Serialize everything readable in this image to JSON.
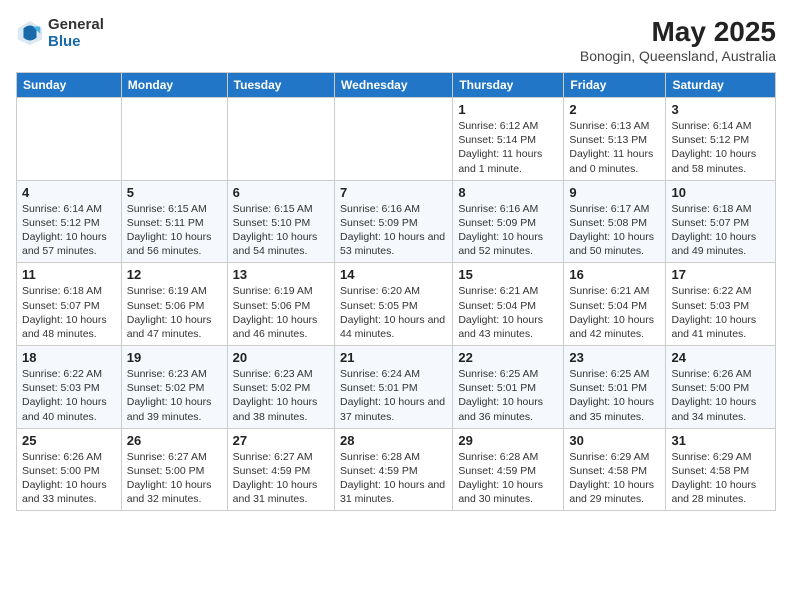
{
  "header": {
    "logo_general": "General",
    "logo_blue": "Blue",
    "month_year": "May 2025",
    "location": "Bonogin, Queensland, Australia"
  },
  "days_of_week": [
    "Sunday",
    "Monday",
    "Tuesday",
    "Wednesday",
    "Thursday",
    "Friday",
    "Saturday"
  ],
  "weeks": [
    [
      {
        "day": "",
        "content": ""
      },
      {
        "day": "",
        "content": ""
      },
      {
        "day": "",
        "content": ""
      },
      {
        "day": "",
        "content": ""
      },
      {
        "day": "1",
        "content": "Sunrise: 6:12 AM\nSunset: 5:14 PM\nDaylight: 11 hours and 1 minute."
      },
      {
        "day": "2",
        "content": "Sunrise: 6:13 AM\nSunset: 5:13 PM\nDaylight: 11 hours and 0 minutes."
      },
      {
        "day": "3",
        "content": "Sunrise: 6:14 AM\nSunset: 5:12 PM\nDaylight: 10 hours and 58 minutes."
      }
    ],
    [
      {
        "day": "4",
        "content": "Sunrise: 6:14 AM\nSunset: 5:12 PM\nDaylight: 10 hours and 57 minutes."
      },
      {
        "day": "5",
        "content": "Sunrise: 6:15 AM\nSunset: 5:11 PM\nDaylight: 10 hours and 56 minutes."
      },
      {
        "day": "6",
        "content": "Sunrise: 6:15 AM\nSunset: 5:10 PM\nDaylight: 10 hours and 54 minutes."
      },
      {
        "day": "7",
        "content": "Sunrise: 6:16 AM\nSunset: 5:09 PM\nDaylight: 10 hours and 53 minutes."
      },
      {
        "day": "8",
        "content": "Sunrise: 6:16 AM\nSunset: 5:09 PM\nDaylight: 10 hours and 52 minutes."
      },
      {
        "day": "9",
        "content": "Sunrise: 6:17 AM\nSunset: 5:08 PM\nDaylight: 10 hours and 50 minutes."
      },
      {
        "day": "10",
        "content": "Sunrise: 6:18 AM\nSunset: 5:07 PM\nDaylight: 10 hours and 49 minutes."
      }
    ],
    [
      {
        "day": "11",
        "content": "Sunrise: 6:18 AM\nSunset: 5:07 PM\nDaylight: 10 hours and 48 minutes."
      },
      {
        "day": "12",
        "content": "Sunrise: 6:19 AM\nSunset: 5:06 PM\nDaylight: 10 hours and 47 minutes."
      },
      {
        "day": "13",
        "content": "Sunrise: 6:19 AM\nSunset: 5:06 PM\nDaylight: 10 hours and 46 minutes."
      },
      {
        "day": "14",
        "content": "Sunrise: 6:20 AM\nSunset: 5:05 PM\nDaylight: 10 hours and 44 minutes."
      },
      {
        "day": "15",
        "content": "Sunrise: 6:21 AM\nSunset: 5:04 PM\nDaylight: 10 hours and 43 minutes."
      },
      {
        "day": "16",
        "content": "Sunrise: 6:21 AM\nSunset: 5:04 PM\nDaylight: 10 hours and 42 minutes."
      },
      {
        "day": "17",
        "content": "Sunrise: 6:22 AM\nSunset: 5:03 PM\nDaylight: 10 hours and 41 minutes."
      }
    ],
    [
      {
        "day": "18",
        "content": "Sunrise: 6:22 AM\nSunset: 5:03 PM\nDaylight: 10 hours and 40 minutes."
      },
      {
        "day": "19",
        "content": "Sunrise: 6:23 AM\nSunset: 5:02 PM\nDaylight: 10 hours and 39 minutes."
      },
      {
        "day": "20",
        "content": "Sunrise: 6:23 AM\nSunset: 5:02 PM\nDaylight: 10 hours and 38 minutes."
      },
      {
        "day": "21",
        "content": "Sunrise: 6:24 AM\nSunset: 5:01 PM\nDaylight: 10 hours and 37 minutes."
      },
      {
        "day": "22",
        "content": "Sunrise: 6:25 AM\nSunset: 5:01 PM\nDaylight: 10 hours and 36 minutes."
      },
      {
        "day": "23",
        "content": "Sunrise: 6:25 AM\nSunset: 5:01 PM\nDaylight: 10 hours and 35 minutes."
      },
      {
        "day": "24",
        "content": "Sunrise: 6:26 AM\nSunset: 5:00 PM\nDaylight: 10 hours and 34 minutes."
      }
    ],
    [
      {
        "day": "25",
        "content": "Sunrise: 6:26 AM\nSunset: 5:00 PM\nDaylight: 10 hours and 33 minutes."
      },
      {
        "day": "26",
        "content": "Sunrise: 6:27 AM\nSunset: 5:00 PM\nDaylight: 10 hours and 32 minutes."
      },
      {
        "day": "27",
        "content": "Sunrise: 6:27 AM\nSunset: 4:59 PM\nDaylight: 10 hours and 31 minutes."
      },
      {
        "day": "28",
        "content": "Sunrise: 6:28 AM\nSunset: 4:59 PM\nDaylight: 10 hours and 31 minutes."
      },
      {
        "day": "29",
        "content": "Sunrise: 6:28 AM\nSunset: 4:59 PM\nDaylight: 10 hours and 30 minutes."
      },
      {
        "day": "30",
        "content": "Sunrise: 6:29 AM\nSunset: 4:58 PM\nDaylight: 10 hours and 29 minutes."
      },
      {
        "day": "31",
        "content": "Sunrise: 6:29 AM\nSunset: 4:58 PM\nDaylight: 10 hours and 28 minutes."
      }
    ]
  ]
}
